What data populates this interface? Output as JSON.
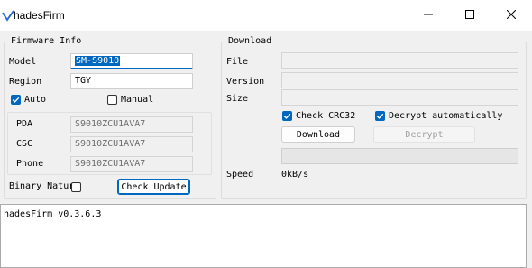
{
  "window": {
    "title": "hadesFirm",
    "controls": {
      "minimize": "—",
      "maximize": "☐",
      "close": "✕"
    }
  },
  "firmware_info": {
    "title": "Firmware Info",
    "model_label": "Model",
    "model_value": "SM-S9010",
    "region_label": "Region",
    "region_value": "TGY",
    "auto_label": "Auto",
    "auto_checked": true,
    "manual_label": "Manual",
    "manual_checked": false,
    "pda_label": "PDA",
    "pda_value": "S9010ZCU1AVA7",
    "csc_label": "CSC",
    "csc_value": "S9010ZCU1AVA7",
    "phone_label": "Phone",
    "phone_value": "S9010ZCU1AVA7",
    "binary_nature_label": "Binary Nature",
    "binary_nature_checked": false,
    "check_update_label": "Check Update"
  },
  "download": {
    "title": "Download",
    "file_label": "File",
    "file_value": "",
    "version_label": "Version",
    "version_value": "",
    "size_label": "Size",
    "size_value": "",
    "check_crc32_label": "Check CRC32",
    "check_crc32_checked": true,
    "decrypt_auto_label": "Decrypt automatically",
    "decrypt_auto_checked": true,
    "download_button_label": "Download",
    "decrypt_button_label": "Decrypt",
    "progress_value": 0,
    "speed_label": "Speed",
    "speed_value": "0kB/s"
  },
  "log": {
    "text": "hadesFirm v0.3.6.3"
  },
  "colors": {
    "accent": "#0067c0",
    "window_bg": "#f0f0f0"
  }
}
